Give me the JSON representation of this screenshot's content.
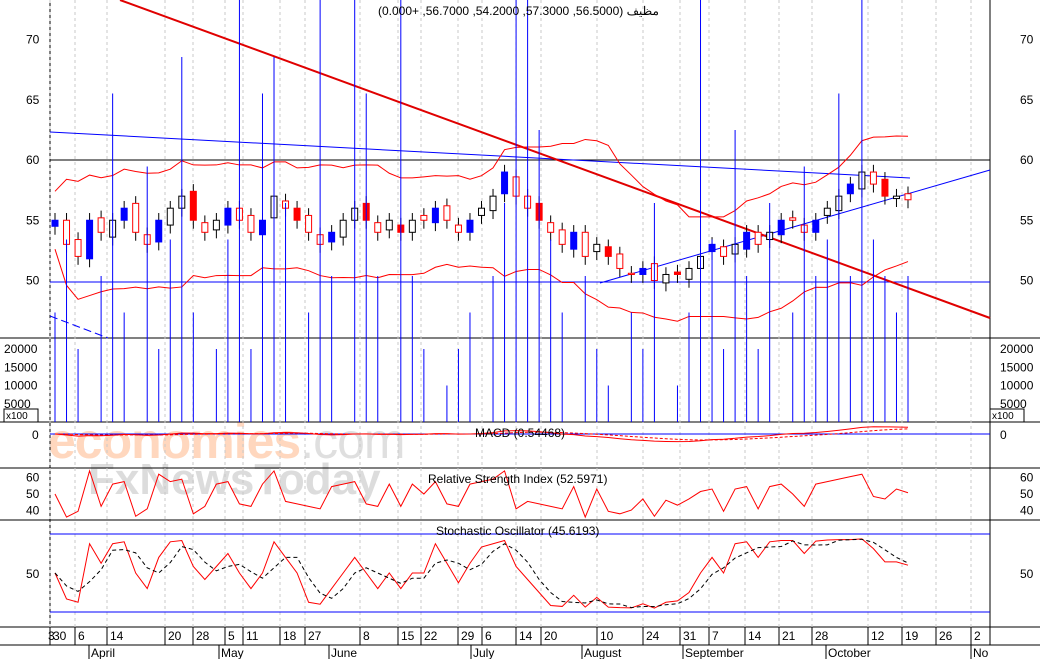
{
  "title": "مظيف (56.5000, 57.3000, 54.2000, 56.7000, +0.000)",
  "watermark": {
    "brand1": "economies",
    "brand1_suffix": ".com",
    "brand2": "FxNewsToday"
  },
  "panels": {
    "macd_label": "MACD (0.54468)",
    "rsi_label": "Relative Strength Index (52.5971)",
    "stoch_label": "Stochastic Oscillator (45.6193)",
    "volume_scale": "x100"
  },
  "colors": {
    "up": "#0000ff",
    "down": "#ff0000",
    "band": "#ff0000",
    "grid": "#bbbbbb"
  },
  "chart_data": {
    "type": "candlestick",
    "price_axis": {
      "ticks": [
        50,
        55,
        60,
        65,
        70
      ],
      "range": [
        45.5,
        73.5
      ]
    },
    "volume_axis": {
      "ticks": [
        5000,
        10000,
        15000,
        20000
      ],
      "labels": [
        "5000",
        "10000",
        "15000",
        "20000"
      ]
    },
    "macd_axis": {
      "ticks": [
        "0"
      ]
    },
    "rsi_axis": {
      "ticks": [
        40,
        50,
        60
      ]
    },
    "stoch_axis": {
      "ticks": [
        50
      ]
    },
    "date_ticks": [
      "3",
      "30",
      "6",
      "14",
      "20",
      "28",
      "5",
      "11",
      "18",
      "27",
      "8",
      "15",
      "22",
      "29",
      "6",
      "14",
      "20",
      "10",
      "24",
      "31",
      "7",
      "14",
      "21",
      "28",
      "12",
      "19",
      "26",
      "2"
    ],
    "months": [
      "April",
      "May",
      "June",
      "July",
      "August",
      "September",
      "October",
      "No"
    ],
    "close": [
      55,
      53,
      52,
      55,
      54,
      55,
      56,
      54,
      53,
      55,
      56,
      57,
      55,
      54,
      55,
      56,
      55,
      54,
      55,
      57,
      56,
      55,
      54,
      53,
      54,
      55,
      56,
      55,
      54,
      55,
      54,
      55,
      55,
      56,
      55,
      54,
      55,
      56,
      57,
      59,
      57,
      56,
      55,
      54,
      53,
      54,
      52,
      53,
      52,
      51,
      50.5,
      51,
      50,
      50.5,
      50.5,
      51,
      52,
      53,
      52,
      53,
      54,
      53,
      54,
      55,
      55,
      54,
      55,
      56,
      57,
      58,
      59,
      58,
      57,
      57,
      56.7
    ],
    "volume": [
      300,
      500,
      200,
      0,
      400,
      900,
      300,
      0,
      700,
      200,
      500,
      1000,
      300,
      0,
      200,
      500,
      1200,
      200,
      900,
      1000,
      600,
      0,
      300,
      1400,
      400,
      0,
      1900,
      900,
      400,
      0,
      1600,
      400,
      200,
      0,
      100,
      200,
      300,
      0,
      400,
      600,
      2000,
      1500,
      800,
      500,
      300,
      0,
      400,
      200,
      100,
      0,
      300,
      200,
      600,
      0,
      100,
      300,
      1400,
      500,
      200,
      800,
      400,
      200,
      600,
      0,
      300,
      700,
      400,
      500,
      900,
      400,
      2000,
      500,
      400,
      300,
      400
    ]
  }
}
